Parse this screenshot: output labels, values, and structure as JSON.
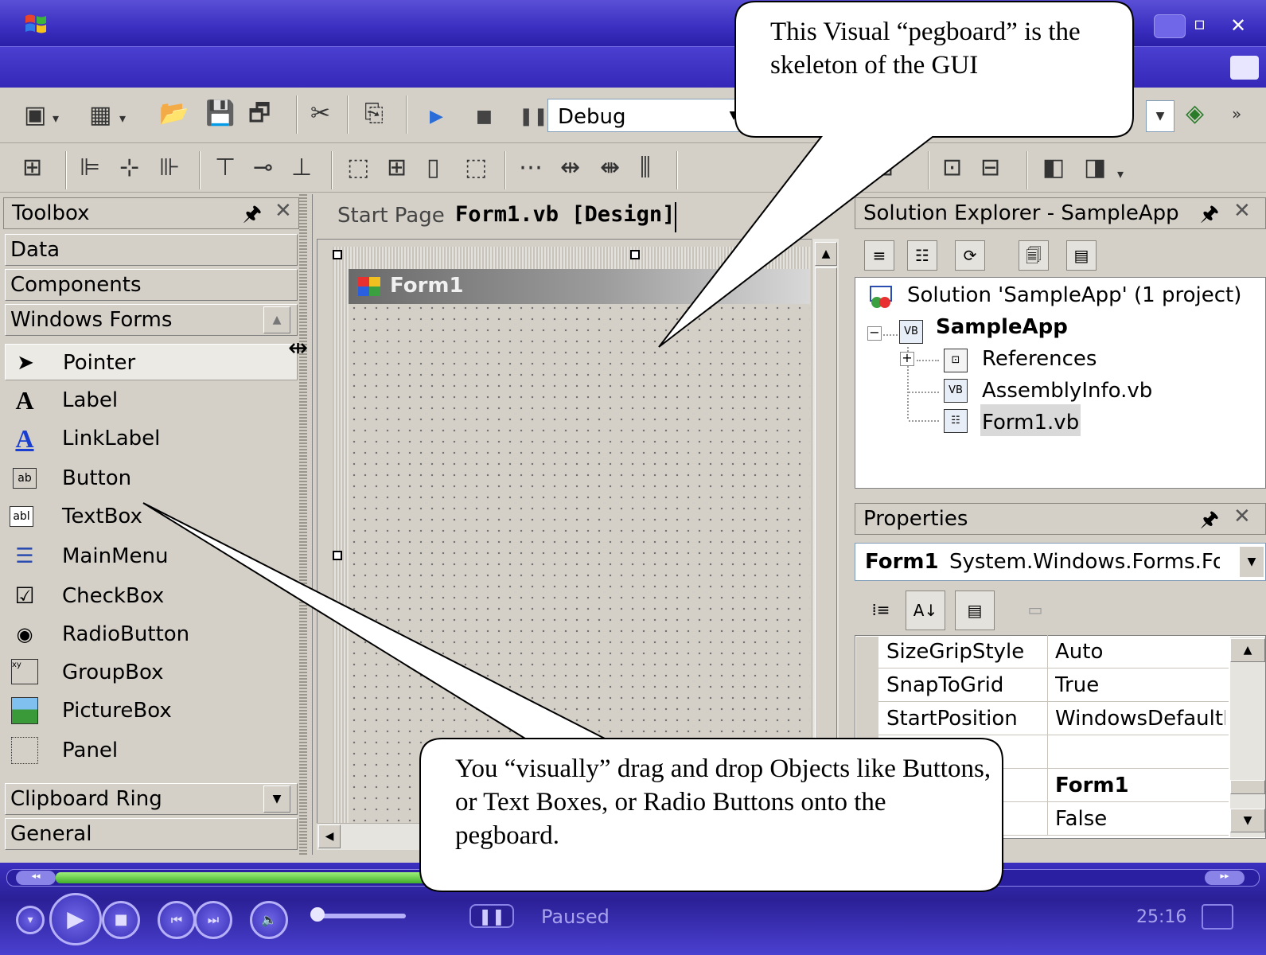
{
  "toolbar": {
    "config": "Debug"
  },
  "toolbox": {
    "title": "Toolbox",
    "tabs_top": [
      "Data",
      "Components",
      "Windows Forms"
    ],
    "items": [
      {
        "label": "Pointer",
        "icon": "pointer-icon"
      },
      {
        "label": "Label",
        "icon": "label-icon"
      },
      {
        "label": "LinkLabel",
        "icon": "linklabel-icon"
      },
      {
        "label": "Button",
        "icon": "button-icon"
      },
      {
        "label": "TextBox",
        "icon": "textbox-icon"
      },
      {
        "label": "MainMenu",
        "icon": "mainmenu-icon"
      },
      {
        "label": "CheckBox",
        "icon": "checkbox-icon"
      },
      {
        "label": "RadioButton",
        "icon": "radiobutton-icon"
      },
      {
        "label": "GroupBox",
        "icon": "groupbox-icon"
      },
      {
        "label": "PictureBox",
        "icon": "picturebox-icon"
      },
      {
        "label": "Panel",
        "icon": "panel-icon"
      }
    ],
    "tabs_bottom": [
      "Clipboard Ring",
      "General"
    ]
  },
  "document": {
    "tabs": [
      "Start Page",
      "Form1.vb [Design]"
    ],
    "form_title": "Form1"
  },
  "solution_explorer": {
    "title": "Solution Explorer - SampleApp",
    "solution": "Solution 'SampleApp' (1 project)",
    "project": "SampleApp",
    "items": [
      "References",
      "AssemblyInfo.vb",
      "Form1.vb"
    ]
  },
  "properties": {
    "title": "Properties",
    "object_name": "Form1",
    "object_type": "System.Windows.Forms.Form",
    "rows": [
      {
        "name": "SizeGripStyle",
        "value": "Auto"
      },
      {
        "name": "SnapToGrid",
        "value": "True"
      },
      {
        "name": "StartPosition",
        "value": "WindowsDefaultLocation"
      },
      {
        "name": "",
        "value": ""
      },
      {
        "name": "",
        "value": "Form1"
      },
      {
        "name": "",
        "value": "False"
      }
    ]
  },
  "media_player": {
    "status": "Paused",
    "time": "25:16"
  },
  "callouts": {
    "top": "This Visual “pegboard” is the skeleton of the GUI",
    "bottom": "You “visually” drag and drop Objects like Buttons, or Text Boxes, or Radio Buttons onto the pegboard."
  },
  "colors": {
    "title_bar": "#3a2fc0",
    "panel_bg": "#d4d0c8",
    "selection": "#d9d9d9",
    "seek_progress": "#3fae2a"
  }
}
